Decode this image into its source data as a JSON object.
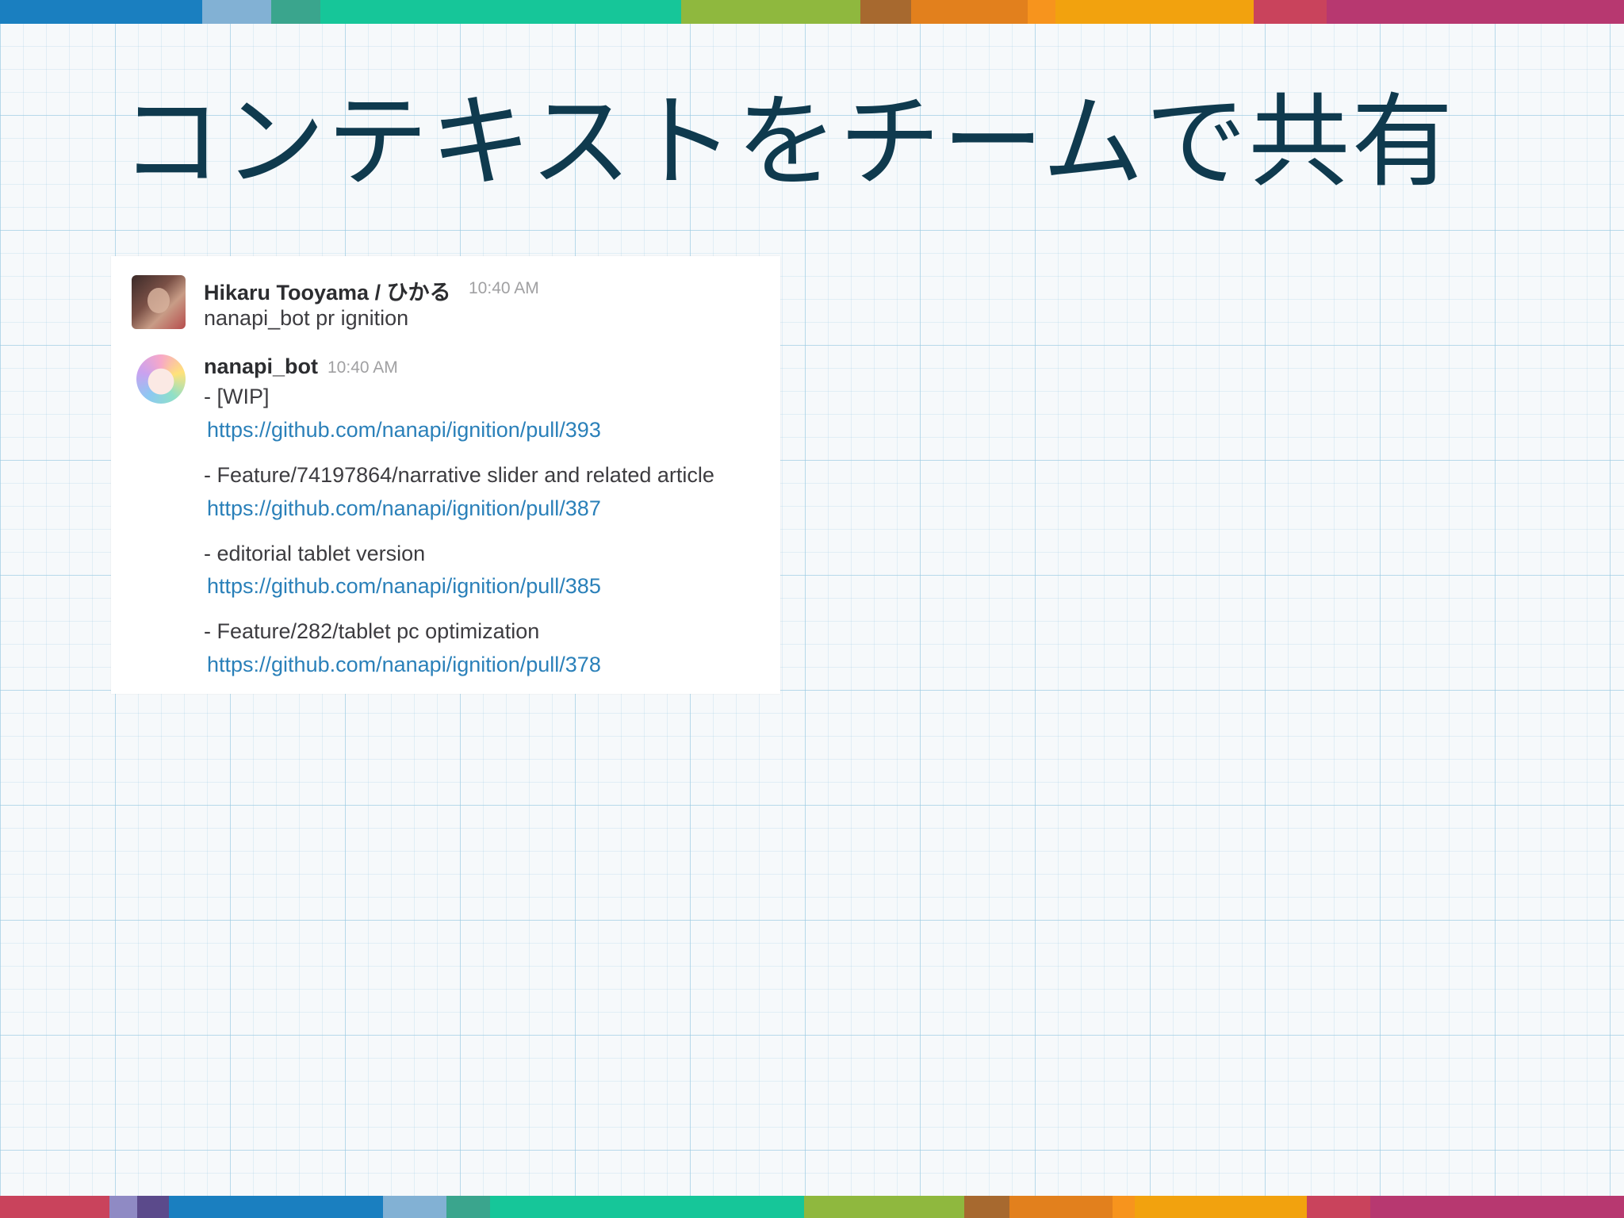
{
  "slide": {
    "title": "コンテキストをチームで共有"
  },
  "chat": {
    "messages": [
      {
        "user": "Hikaru Tooyama / ひかる",
        "time": "10:40 AM",
        "text": "nanapi_bot pr ignition"
      },
      {
        "user": "nanapi_bot",
        "time": "10:40 AM",
        "items": [
          {
            "title": "- [WIP]",
            "link": "https://github.com/nanapi/ignition/pull/393"
          },
          {
            "title": "- Feature/74197864/narrative slider and related article",
            "link": "https://github.com/nanapi/ignition/pull/387"
          },
          {
            "title": "- editorial tablet version",
            "link": "https://github.com/nanapi/ignition/pull/385"
          },
          {
            "title": "- Feature/282/tablet pc optimization",
            "link": "https://github.com/nanapi/ignition/pull/378"
          }
        ]
      }
    ]
  },
  "colors": {
    "title": "#0f3a4e",
    "link": "#2a80b9",
    "stripe": [
      "#1a7fc0",
      "#82b1d4",
      "#3aa58d",
      "#16c699",
      "#8fb83e",
      "#b36c2d",
      "#e2801d",
      "#f2a20e",
      "#c9435c",
      "#b73870"
    ]
  }
}
